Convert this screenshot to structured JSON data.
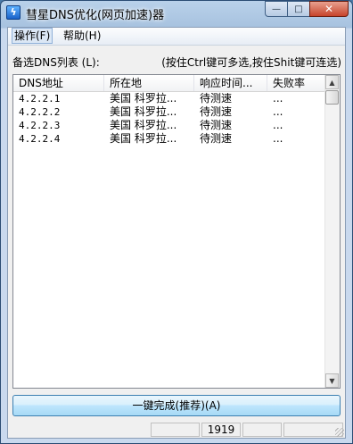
{
  "window": {
    "title": "彗星DNS优化(网页加速)器",
    "icon": "lightning-icon",
    "controls": {
      "minimize": "—",
      "maximize": "□",
      "close": "✕"
    }
  },
  "menu": {
    "items": [
      {
        "label": "操作(F)"
      },
      {
        "label": "帮助(H)"
      }
    ]
  },
  "labels": {
    "list_caption": "备选DNS列表 (L):",
    "hint": "(按住Ctrl键可多选,按住Shit键可连选)"
  },
  "table": {
    "columns": [
      "DNS地址",
      "所在地",
      "响应时间...",
      "失败率"
    ],
    "rows": [
      {
        "address": "4.2.2.1",
        "location": "美国 科罗拉...",
        "response": "待测速",
        "failure": "..."
      },
      {
        "address": "4.2.2.2",
        "location": "美国 科罗拉...",
        "response": "待测速",
        "failure": "..."
      },
      {
        "address": "4.2.2.3",
        "location": "美国 科罗拉...",
        "response": "待测速",
        "failure": "..."
      },
      {
        "address": "4.2.2.4",
        "location": "美国 科罗拉...",
        "response": "待测速",
        "failure": "..."
      }
    ]
  },
  "actions": {
    "one_click": "一键完成(推荐)(A)"
  },
  "status": {
    "panels": [
      "",
      "",
      "1919",
      ""
    ]
  }
}
